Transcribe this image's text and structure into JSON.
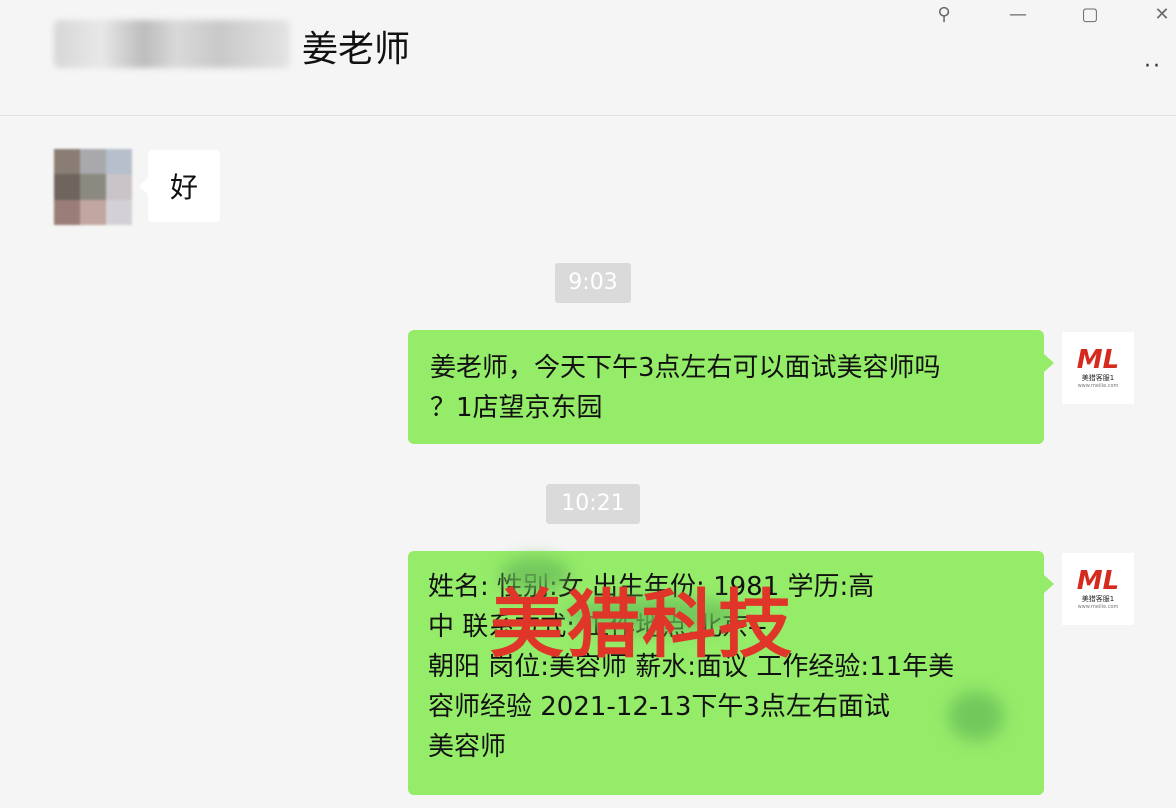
{
  "header": {
    "contact_name": "姜老师",
    "more_label": "··",
    "buttons": {
      "pin": "⚲",
      "minimize": "—",
      "maximize": "▢",
      "close": "✕"
    }
  },
  "messages": {
    "incoming_1": {
      "text": "好"
    },
    "timestamp_1": "9:03",
    "outgoing_1": {
      "lines": [
        "姜老师，今天下午3点左右可以面试美容师吗",
        "？1店望京东园"
      ]
    },
    "timestamp_2": "10:21",
    "outgoing_2": {
      "lines": [
        "姓名:        性别:女 出生年份: 1981 学历:高",
        "中 联系方式:                工作地点:北京--",
        "朝阳 岗位:美容师 薪水:面议 工作经验:11年美",
        "容师经验 2021-12-13下午3点左右面试",
        "美容师"
      ]
    }
  },
  "watermark": "美猎科技",
  "logo": {
    "mark": "ML",
    "text": "美猎客服1",
    "sub": "www.meilie.com"
  },
  "colors": {
    "bubble_green": "#95ec69",
    "background": "#f5f5f5",
    "timestamp_bg": "#dadada",
    "watermark_red": "#e0362a"
  }
}
